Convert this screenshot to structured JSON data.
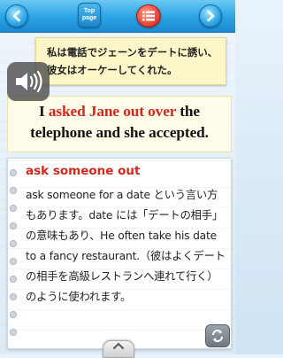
{
  "toolbar": {
    "back_icon": "left-arrow-icon",
    "top_page_label": "Top page",
    "list_icon": "list-icon",
    "next_icon": "right-arrow-icon"
  },
  "sentence_jp": "私は電話でジェーンをデートに誘い、彼女はオーケーしてくれた。",
  "sentence_en": {
    "before": "I ",
    "highlight": "asked Jane out over",
    "after": " the telephone and she accepted."
  },
  "note": {
    "phrase": "ask someone out",
    "explanation": "ask someone for a date という言い方もあります。date には「デートの相手」の意味もあり、He often take his date to a fancy restaurant.（彼はよくデートの相手を高級レストランへ連れて行く）のように使われます。"
  },
  "audio_icon": "speaker-icon",
  "repeat_icon": "repeat-icon",
  "colors": {
    "toolbar": "#2aa3e3",
    "highlight": "#d2271d",
    "jp_card": "#fdf6c8"
  }
}
